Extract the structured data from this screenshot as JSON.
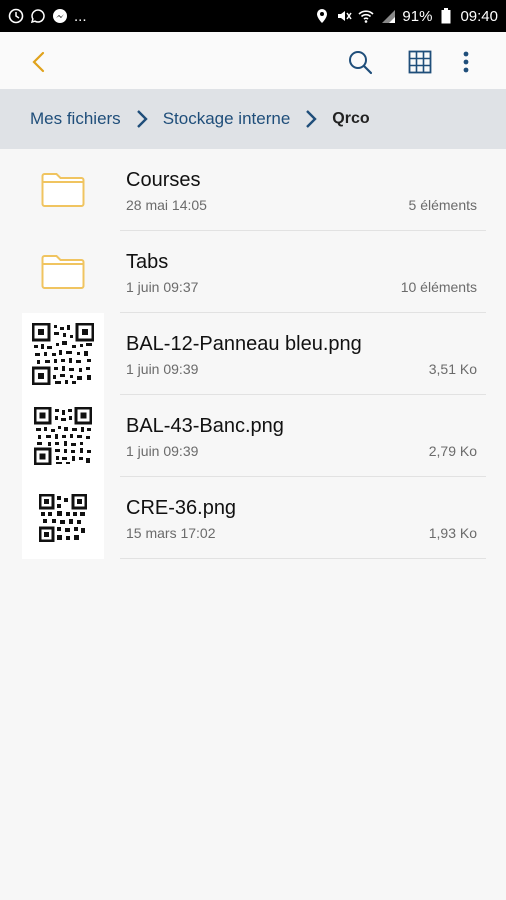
{
  "status_bar": {
    "left_icons": [
      "clock-icon",
      "messenger-icon",
      "messenger-icon"
    ],
    "dots": "...",
    "right_icons": [
      "location-icon",
      "mute-icon",
      "wifi-icon",
      "signal-icon",
      "battery-icon"
    ],
    "battery": "91%",
    "time": "09:40"
  },
  "app_bar": {
    "actions": [
      "back-icon",
      "search-icon",
      "grid-view-icon",
      "more-vert-icon"
    ],
    "accent_color": "#e0a21c"
  },
  "breadcrumb": {
    "items": [
      "Mes fichiers",
      "Stockage interne",
      "Qrco"
    ]
  },
  "files": [
    {
      "type": "folder",
      "name": "Courses",
      "date": "28 mai 14:05",
      "meta": "5 éléments"
    },
    {
      "type": "folder",
      "name": "Tabs",
      "date": "1 juin 09:37",
      "meta": "10 éléments"
    },
    {
      "type": "image",
      "name": "BAL-12-Panneau bleu.png",
      "date": "1 juin 09:39",
      "meta": "3,51 Ko"
    },
    {
      "type": "image",
      "name": "BAL-43-Banc.png",
      "date": "1 juin 09:39",
      "meta": "2,79 Ko"
    },
    {
      "type": "image",
      "name": "CRE-36.png",
      "date": "15 mars 17:02",
      "meta": "1,93 Ko"
    }
  ]
}
